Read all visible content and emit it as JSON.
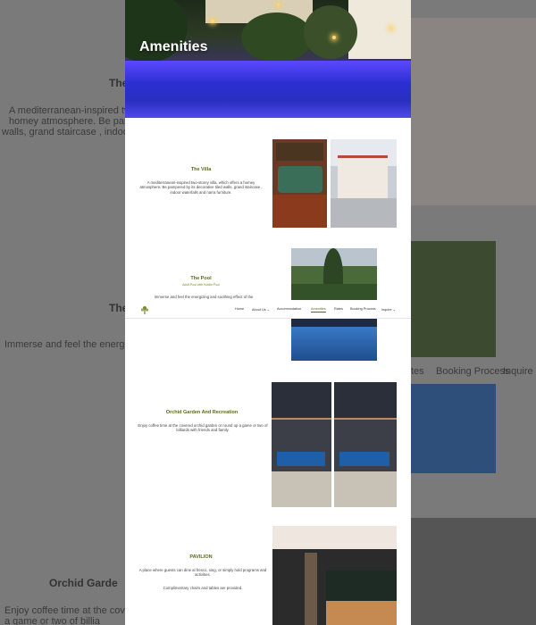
{
  "hero": {
    "title": "Amenities"
  },
  "nav": {
    "items": [
      {
        "label": "Home"
      },
      {
        "label": "About Us ⌄"
      },
      {
        "label": "Accommodation"
      },
      {
        "label": "Amenities"
      },
      {
        "label": "Rates"
      },
      {
        "label": "Booking Process"
      },
      {
        "label": "Inquire ⌄"
      }
    ]
  },
  "sections": [
    {
      "title": "The Villa",
      "body": "A mediterranean-inspired two-storey villa, which offers a homey atmosphere. Be pampered by its decorative tiled walls, grand staircase , indoor waterfalls and narra furniture."
    },
    {
      "title": "The Pool",
      "subtitle": "Adult Pool with Kiddie Pool",
      "body": "Immerse and feel the energizing and soothing effect of the"
    },
    {
      "title": "Orchid Garden And Recreation",
      "body": "Enjoy coffee time at the covered orchid garden or round up a game or two of billiards with friends and family."
    },
    {
      "title": "PAVILION",
      "body": "A place where guests can dine al fresco, sing, or simply hold programs and activities.",
      "body2": "Complimentary chairs and tables are provided."
    }
  ],
  "backdrop": {
    "text1": "A mediterranean-inspired two-storey villa, which offers a",
    "text2": "homey atmosphere. Be pampered by its",
    "text3": "walls, grand staircase , indoor",
    "title2": "The",
    "text4": "Immerse and feel the energ",
    "title3": "Orchid Garde",
    "text5": "Enjoy coffee time at the cove",
    "text6": "a game or two of billia",
    "nav1": "Booking Process",
    "nav2": "Inquire",
    "nav3": "tes"
  },
  "colors": {
    "accent": "#5b6a1a",
    "pool": "#3a3ad6"
  }
}
